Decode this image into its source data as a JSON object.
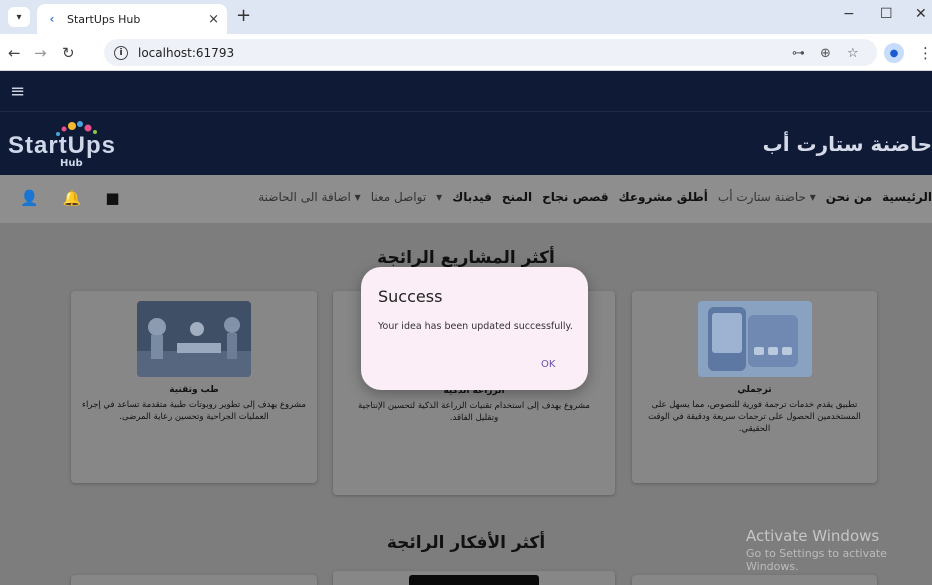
{
  "browser": {
    "tab_title": "StartUps Hub",
    "tab_close": "×",
    "new_tab": "+",
    "url": "localhost:61793",
    "minimize": "−",
    "maximize": "☐",
    "close": "✕"
  },
  "site": {
    "logo_text": "StartUps",
    "logo_sub": "Hub",
    "brand_title": "حاضنة ستارت أب",
    "menu": [
      {
        "label": "الرئيسية",
        "style": "bold"
      },
      {
        "label": "من نحن",
        "style": "bold"
      },
      {
        "label": "▾ حاضنة ستارت أب",
        "style": "light"
      },
      {
        "label": "أطلق مشروعك",
        "style": "bold"
      },
      {
        "label": "قصص نجاح",
        "style": "bold"
      },
      {
        "label": "المنح",
        "style": "bold"
      },
      {
        "label": "فيدباك",
        "style": "bold"
      },
      {
        "label": "▾",
        "style": "light"
      },
      {
        "label": "تواصل معنا",
        "style": "light"
      },
      {
        "label": "▾ اضافة الى الحاضنة",
        "style": "light"
      }
    ],
    "icons": [
      "person-icon",
      "notification-icon",
      "chat-icon"
    ]
  },
  "sections": {
    "top_projects": "أكثر المشاريع الرائجة",
    "top_ideas": "أكثر الأفكار الرائجة"
  },
  "cards": [
    {
      "title": "ترجملي",
      "desc": "تطبيق يقدم خدمات ترجمة فورية للنصوص، مما يسهل على المستخدمين الحصول على ترجمات سريعة ودقيقة في الوقت الحقيقي."
    },
    {
      "title": "الزراعة الذكية",
      "desc": "مشروع يهدف إلى استخدام تقنيات الزراعة الذكية لتحسين الإنتاجية وتقليل الفاقد."
    },
    {
      "title": "طب وتقنية",
      "desc": "مشروع يهدف إلى تطوير روبوتات طبية متقدمة تساعد في إجراء العمليات الجراحية وتحسين رعاية المرضى."
    }
  ],
  "dialog": {
    "title": "Success",
    "message": "Your idea has been updated successfully.",
    "ok": "OK"
  },
  "watermark": {
    "line1": "Activate Windows",
    "line2": "Go to Settings to activate Windows."
  },
  "colors": {
    "header_bg": "#0e1a36",
    "overlay_bg": "#7d7d7d",
    "dialog_bg": "#fbeef7",
    "dialog_accent": "#6a4fa8"
  }
}
